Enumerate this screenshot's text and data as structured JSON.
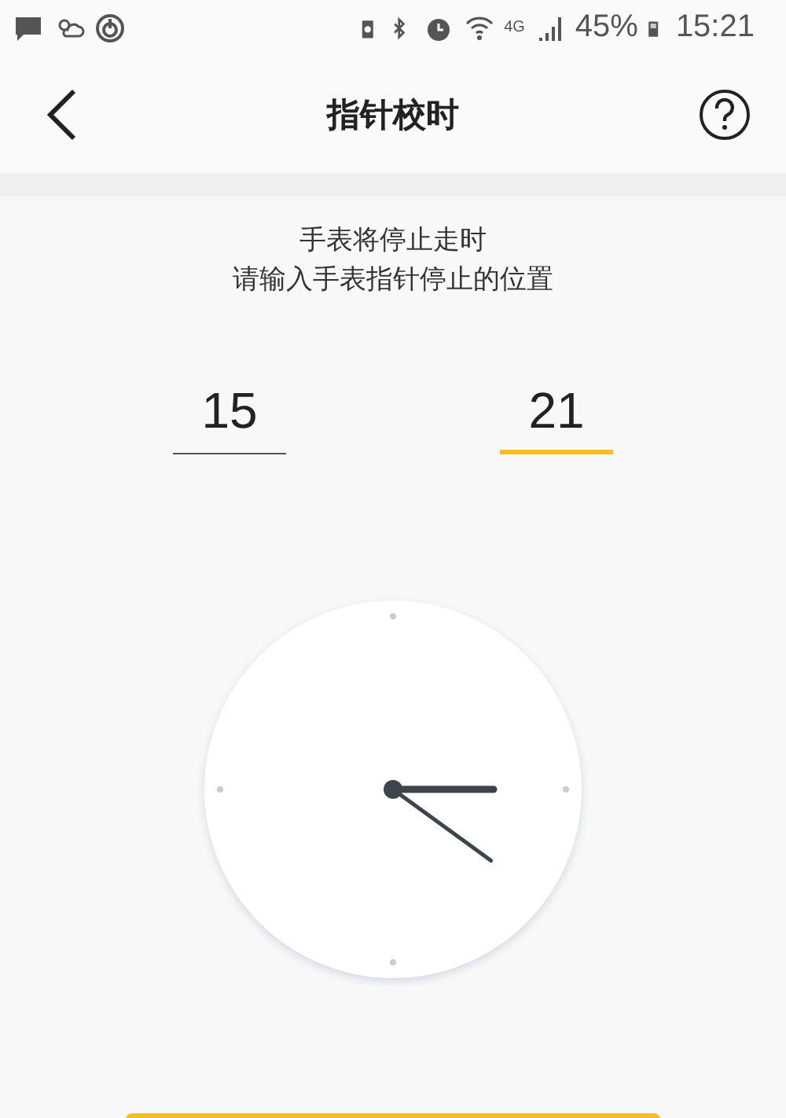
{
  "status_bar": {
    "network": "4G",
    "battery": "45%",
    "time": "15:21"
  },
  "header": {
    "title": "指针校时"
  },
  "instructions": [
    "手表将停止走时",
    "请输入手表指针停止的位置"
  ],
  "fields": [
    {
      "kind": "hour",
      "value": "15",
      "selected": false
    },
    {
      "kind": "minute",
      "value": "21",
      "selected": true
    }
  ]
}
